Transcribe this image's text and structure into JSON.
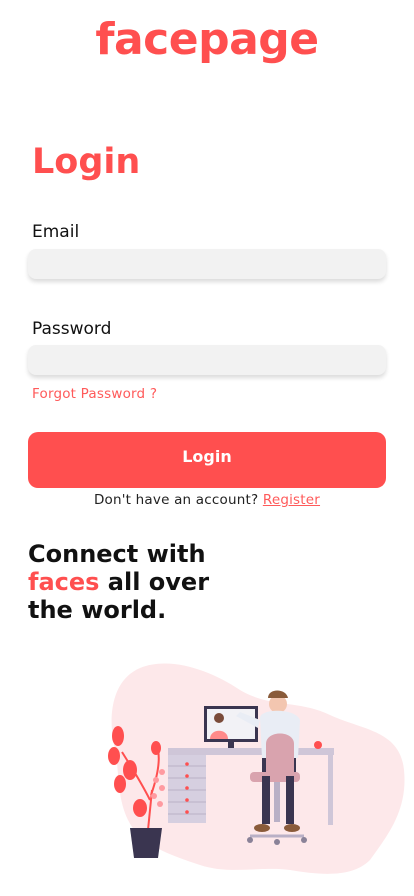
{
  "brand": {
    "name": "facepage",
    "color": "#ff4f4f"
  },
  "login_form": {
    "title": "Login",
    "email_label": "Email",
    "email_value": "",
    "password_label": "Password",
    "password_value": "",
    "forgot_password": "Forgot Password ?",
    "submit_label": "Login",
    "no_account_text": "Don't have an account?",
    "register_link": "Register"
  },
  "tagline": {
    "line1": "Connect with",
    "line2_accent": "faces",
    "line2_rest": " all over",
    "line3": "the world."
  },
  "illustration": {
    "subject": "person at desk on video call",
    "accent_color": "#ff4f4f",
    "blob_color": "#fde8ea"
  }
}
